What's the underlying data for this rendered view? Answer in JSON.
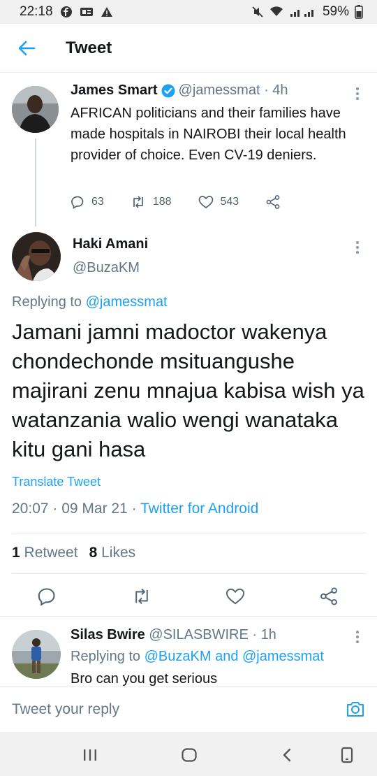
{
  "status_bar": {
    "time": "22:18",
    "battery": "59%"
  },
  "header": {
    "title": "Tweet"
  },
  "parent_tweet": {
    "name": "James Smart",
    "handle_meta": "@jamessmat · 4h",
    "text": "AFRICAN politicians and their families have made hospitals in NAIROBI their local health provider of choice. Even CV-19 deniers.",
    "reply_count": "63",
    "retweet_count": "188",
    "like_count": "543"
  },
  "main_tweet": {
    "name": "Haki Amani",
    "handle": "@BuzaKM",
    "replying_prefix": "Replying to ",
    "replying_handle": "@jamessmat",
    "text": "Jamani jamni madoctor wakenya chondechonde msituangushe majirani zenu mnajua kabisa wish ya watanzania walio wengi wanataka kitu gani hasa",
    "translate_label": "Translate Tweet",
    "timestamp": "20:07 · 09 Mar 21 · ",
    "source": "Twitter for Android",
    "retweets_count": "1",
    "retweets_label": "Retweet",
    "likes_count": "8",
    "likes_label": "Likes"
  },
  "reply_tweet": {
    "name": "Silas Bwire",
    "handle_meta": "@SILASBWIRE · 1h",
    "replying_prefix": "Replying to ",
    "replying_handles": "@BuzaKM and @jamessmat",
    "text": "Bro can you get serious"
  },
  "composer": {
    "placeholder": "Tweet your reply"
  },
  "colors": {
    "accent": "#1da1f2",
    "secondary_text": "#657786",
    "primary_text": "#14171a"
  }
}
